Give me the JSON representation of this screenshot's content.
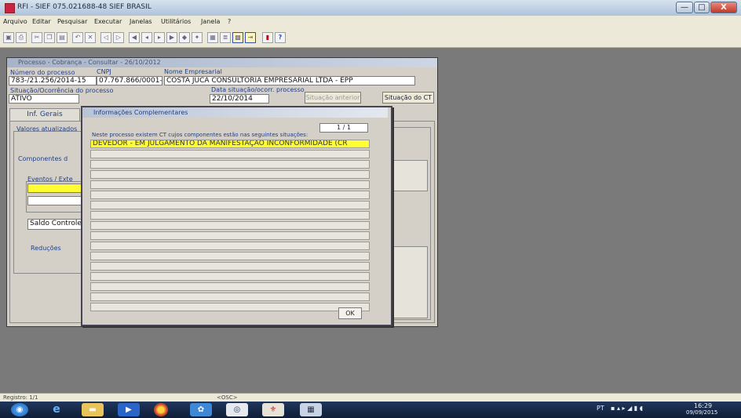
{
  "window": {
    "title": "RFI - SIEF          075.021688-48   SIEF BRASIL",
    "controls": {
      "minimize": "—",
      "maximize": "□",
      "close": "X"
    }
  },
  "menu": [
    "Arquivo",
    "Editar",
    "Pesquisar",
    "Executar",
    "Janelas",
    "Utilitários",
    "Janela",
    "?"
  ],
  "toolbar": {
    "icons": [
      "save-icon",
      "print-icon",
      "cut-icon",
      "copy-icon",
      "paste-icon",
      "undo-icon",
      "clear-icon",
      "first-record-icon",
      "prev-record-icon",
      "next-record-icon",
      "last-record-icon",
      "insert-icon",
      "delete-icon",
      "query-icon",
      "execute-icon",
      "calendar-icon",
      "exit-icon",
      "help-icon"
    ],
    "help_label": "?"
  },
  "process_window": {
    "title": "Processo - Cobrança - Consultar - 26/10/2012",
    "labels": {
      "numero": "Número do processo",
      "cnpj": "CNPJ",
      "nome": "Nome Empresarial",
      "situacao": "Situação/Ocorrência do processo",
      "data": "Data situação/ocorr. processo"
    },
    "values": {
      "numero": "783-/21.256/2014-15",
      "cnpj": "07.767.866/0001-01",
      "nome": "COSTA JUCA CONSULTORIA EMPRESARIAL LTDA - EPP",
      "situacao": "ATIVO",
      "data": "22/10/2014"
    },
    "buttons": {
      "situacao_anterior": "Situação anterior",
      "situacao_ct": "Situação do CT"
    },
    "tab": "Inf. Gerais",
    "sections": {
      "valores": "Valores atualizados",
      "componentes": "Componentes d",
      "eventos": "Eventos / Exte",
      "saldo": "Saldo Controle",
      "reducoes": "Reduções"
    }
  },
  "dialog": {
    "title": "Informações Complementares",
    "page_indicator": "1 / 1",
    "message": "Neste processo existem CT cujos componentes estão nas seguintes situações:",
    "selected_row": "DEVEDOR - EM JULGAMENTO DA MANIFESTAÇÃO INCONFORMIDADE (CR",
    "empty_rows": 16,
    "ok_label": "OK"
  },
  "statusbar": {
    "record": "Registro: 1/1",
    "mode": "<OSC>"
  },
  "taskbar": {
    "apps": [
      "start-orb-icon",
      "ie-icon",
      "explorer-icon",
      "media-player-icon",
      "chrome-icon",
      "network-icon",
      "outlook-icon",
      "sief-icon",
      "word-icon"
    ],
    "lang": "PT",
    "time": "16:29",
    "date": "09/09/2015"
  },
  "colors": {
    "selected_row": "#ffff33",
    "label_blue": "#1f3f8a",
    "workspace": "#7a7a7a"
  }
}
